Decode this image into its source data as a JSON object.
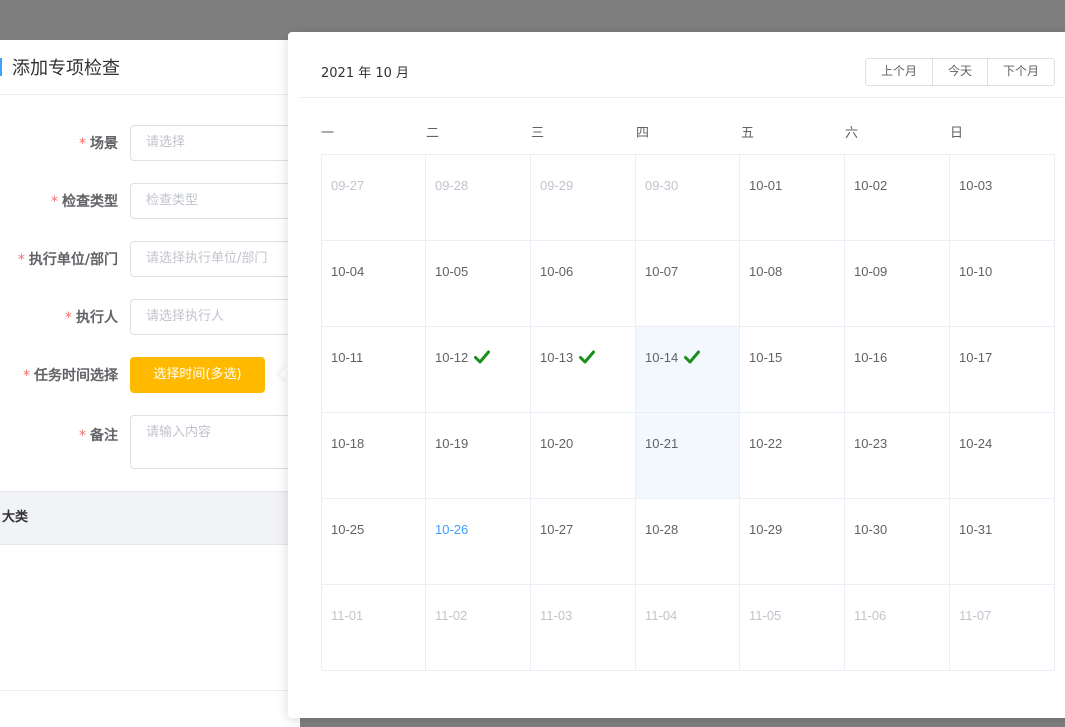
{
  "dialog": {
    "title": "添加专项检查",
    "fields": [
      {
        "label": "场景",
        "placeholder": "请选择"
      },
      {
        "label": "检查类型",
        "placeholder": "检查类型"
      },
      {
        "label": "执行单位/部门",
        "placeholder": "请选择执行单位/部门"
      },
      {
        "label": "执行人",
        "placeholder": "请选择执行人"
      },
      {
        "label": "任务时间选择",
        "button": "选择时间(多选)"
      },
      {
        "label": "备注",
        "placeholder": "请输入内容"
      }
    ],
    "required_mark": "*",
    "table_header": "大类"
  },
  "calendar": {
    "title": "2021 年 10 月",
    "buttons": [
      "上个月",
      "今天",
      "下个月"
    ],
    "weekdays": [
      "一",
      "二",
      "三",
      "四",
      "五",
      "六",
      "日"
    ],
    "weeks": [
      [
        "09-27",
        "09-28",
        "09-29",
        "09-30",
        "10-01",
        "10-02",
        "10-03"
      ],
      [
        "10-04",
        "10-05",
        "10-06",
        "10-07",
        "10-08",
        "10-09",
        "10-10"
      ],
      [
        "10-11",
        "10-12",
        "10-13",
        "10-14",
        "10-15",
        "10-16",
        "10-17"
      ],
      [
        "10-18",
        "10-19",
        "10-20",
        "10-21",
        "10-22",
        "10-23",
        "10-24"
      ],
      [
        "10-25",
        "10-26",
        "10-27",
        "10-28",
        "10-29",
        "10-30",
        "10-31"
      ],
      [
        "11-01",
        "11-02",
        "11-03",
        "11-04",
        "11-05",
        "11-06",
        "11-07"
      ]
    ],
    "selected_dates": [
      "10-12",
      "10-13",
      "10-14"
    ],
    "highlighted_dates": [
      "10-14",
      "10-21"
    ],
    "today": "10-26",
    "other_month_dates": [
      "09-27",
      "09-28",
      "09-29",
      "09-30",
      "11-01",
      "11-02",
      "11-03",
      "11-04",
      "11-05",
      "11-06",
      "11-07"
    ],
    "selected_icon": "check-icon"
  },
  "colors": {
    "primary": "#409eff",
    "warning_button": "#ffba00",
    "required": "#f56c6c",
    "check": "#1a8f1a",
    "highlight_bg": "#f2f8fe",
    "overlay": "#7f7f7f"
  }
}
